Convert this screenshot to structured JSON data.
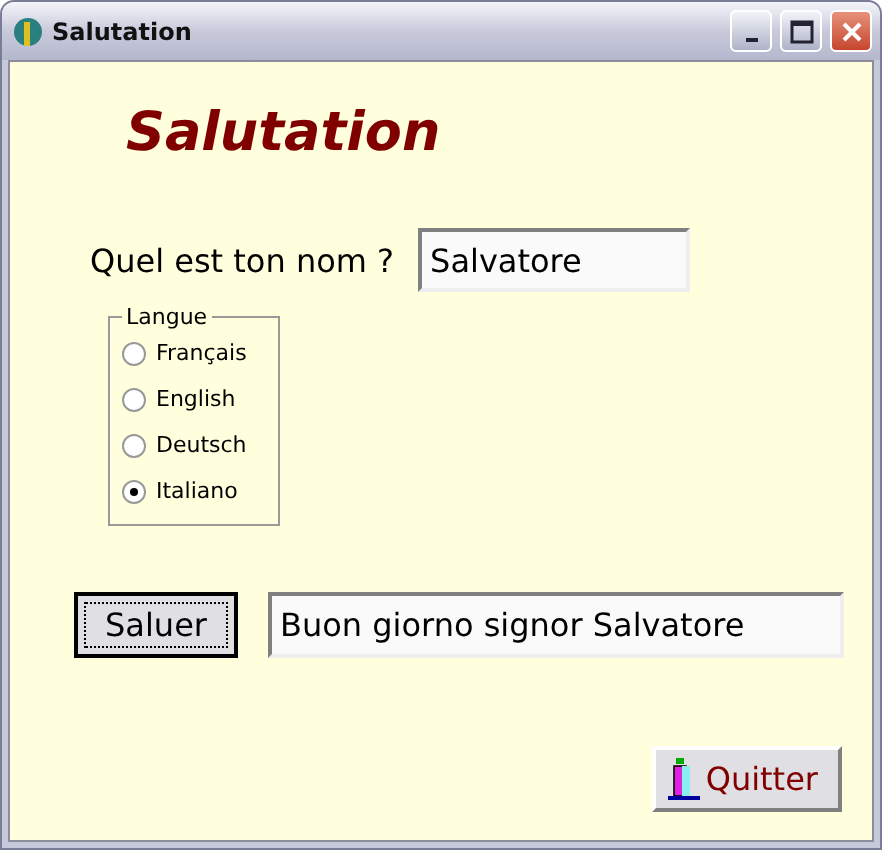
{
  "window": {
    "title": "Salutation"
  },
  "heading": "Salutation",
  "name_prompt": {
    "label": "Quel est ton nom ?",
    "value": "Salvatore"
  },
  "language_group": {
    "title": "Langue",
    "options": [
      {
        "label": "Français",
        "selected": false
      },
      {
        "label": "English",
        "selected": false
      },
      {
        "label": "Deutsch",
        "selected": false
      },
      {
        "label": "Italiano",
        "selected": true
      }
    ]
  },
  "greet_button": {
    "label": "Saluer",
    "focused": true
  },
  "greeting_output": "Buon giorno signor Salvatore",
  "quit_button": {
    "label": "Quitter"
  }
}
